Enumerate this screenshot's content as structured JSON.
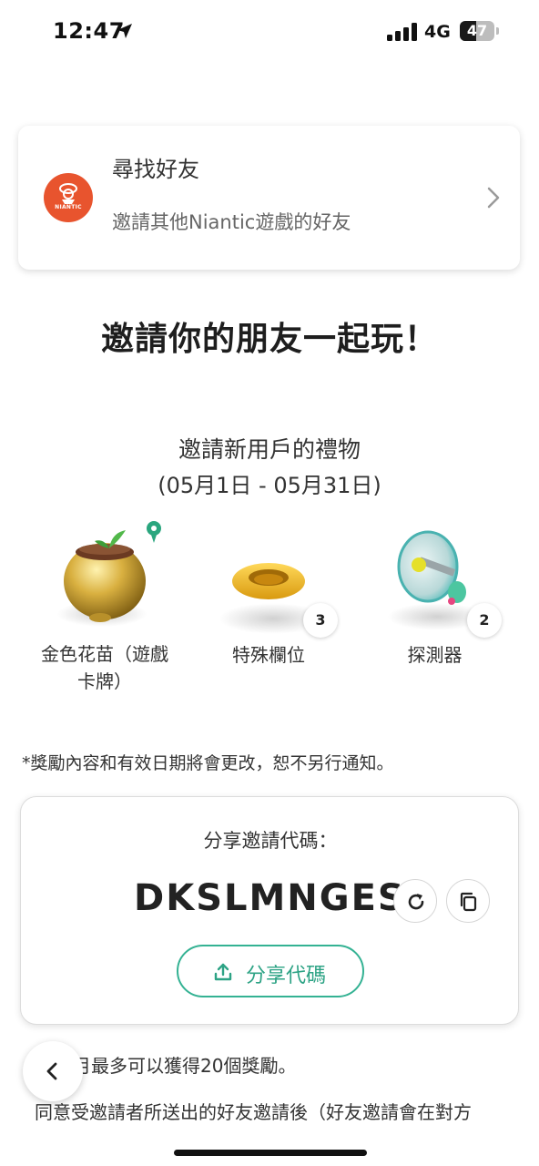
{
  "status_bar": {
    "time": "12:47",
    "network": "4G",
    "battery_level": "47",
    "icons": [
      "location-arrow-icon",
      "signal-bars-icon",
      "battery-icon"
    ]
  },
  "find_friends": {
    "title": "尋找好友",
    "subtitle": "邀請其他Niantic遊戲的好友",
    "logo_text": "NIANTIC",
    "logo_color": "#e8542e"
  },
  "headline": "邀請你的朋友一起玩！",
  "gift": {
    "title": "邀請新用戶的禮物",
    "dates": "(05月1日 - 05月31日)"
  },
  "rewards": [
    {
      "label_line1": "金色花苗（遊戲",
      "label_line2": "卡牌）",
      "icon": "golden-planter-icon"
    },
    {
      "label": "特殊欄位",
      "count": "3",
      "icon": "special-slot-icon"
    },
    {
      "label": "探測器",
      "count": "2",
      "icon": "detector-icon"
    }
  ],
  "notice": "*獎勵內容和有效日期將會更改，恕不另行通知。",
  "share": {
    "label": "分享邀請代碼：",
    "code": "DKSLMNGES",
    "button_label": "分享代碼",
    "accent_color": "#34b293"
  },
  "body": {
    "line1": "月最多可以獲得20個獎勵。",
    "line2": "同意受邀請者所送出的好友邀請後（好友邀請會在對方"
  }
}
